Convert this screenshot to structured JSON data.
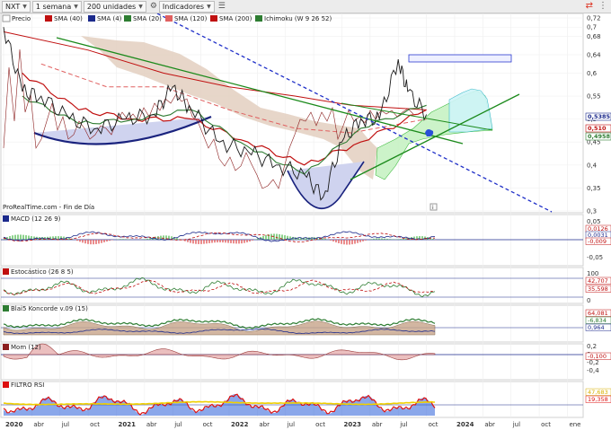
{
  "toolbar": {
    "ticker": "NXT",
    "period": "1 semana",
    "units": "200 unidades",
    "indicators": "Indicadores"
  },
  "legend": {
    "price": "Precio",
    "sma40": "SMA (40)",
    "sma4": "SMA (4)",
    "sma20": "SMA (20)",
    "sma120": "SMA (120)",
    "sma200": "SMA (200)",
    "ichimoku": "Ichimoku (W 9 26 52)"
  },
  "source_text": "ProRealTime.com - Fin de Día",
  "colors": {
    "price": "#1a1a1a",
    "sma40": "#c01010",
    "sma4": "#1c2a8c",
    "sma20": "#2e7d32",
    "sma120": "#e06060",
    "sma200": "#c01010",
    "kumo": "#e3cfc0",
    "kumo_green": "#c7f2c4",
    "cup_fill": "#cfd3ef",
    "cup_line": "#1a237e",
    "trend_green": "#1b8a1b",
    "trend_blue": "#1f2fc8",
    "macd": "#1c2a8c",
    "rsi_red": "#d11",
    "rsi_blue": "#2a5fd8",
    "rsi_yellow": "#f0d000"
  },
  "chart_data": [
    {
      "type": "line",
      "title": "NXT",
      "x_ticks": [
        "2020",
        "abr",
        "jul",
        "oct",
        "2021",
        "abr",
        "jul",
        "oct",
        "2022",
        "abr",
        "jul",
        "oct",
        "2023",
        "abr",
        "jul",
        "oct",
        "2024",
        "abr",
        "jul",
        "oct",
        "ene"
      ],
      "y_ticks": [
        "0,72",
        "0,7",
        "0,68",
        "0,64",
        "0,6",
        "0,55",
        "0,5",
        "0,45",
        "0,4",
        "0,35",
        "0,3"
      ],
      "ylim": [
        0.3,
        0.72
      ],
      "price_tags": [
        {
          "text": "0,5385",
          "color": "#1c2a8c"
        },
        {
          "text": "0,510",
          "color": "#c01010"
        },
        {
          "text": "0,4958",
          "color": "#2e7d32"
        }
      ],
      "series": [
        {
          "name": "Precio",
          "x": [
            "2020-01",
            "2020-03",
            "2020-05",
            "2020-08",
            "2020-11",
            "2021-02",
            "2021-05",
            "2021-07",
            "2021-09",
            "2021-12",
            "2022-03",
            "2022-06",
            "2022-09",
            "2022-11",
            "2023-01",
            "2023-03",
            "2023-05",
            "2023-07",
            "2023-08",
            "2023-10"
          ],
          "values": [
            0.7,
            0.56,
            0.55,
            0.5,
            0.48,
            0.5,
            0.51,
            0.57,
            0.52,
            0.45,
            0.43,
            0.4,
            0.38,
            0.33,
            0.45,
            0.5,
            0.5,
            0.63,
            0.56,
            0.51
          ]
        },
        {
          "name": "SMA (200)",
          "x": [
            "2020-01",
            "2020-10",
            "2021-06",
            "2022-01",
            "2022-08",
            "2023-02",
            "2023-10"
          ],
          "values": [
            0.69,
            0.65,
            0.6,
            0.57,
            0.55,
            0.53,
            0.52
          ]
        },
        {
          "name": "SMA (120)",
          "x": [
            "2020-05",
            "2020-12",
            "2021-06",
            "2022-01",
            "2022-08",
            "2023-02",
            "2023-10"
          ],
          "values": [
            0.62,
            0.57,
            0.57,
            0.52,
            0.48,
            0.47,
            0.5
          ]
        },
        {
          "name": "SMA (40)",
          "x": [
            "2020-03",
            "2020-09",
            "2021-03",
            "2021-09",
            "2022-03",
            "2022-09",
            "2023-03",
            "2023-10"
          ],
          "values": [
            0.6,
            0.52,
            0.5,
            0.5,
            0.45,
            0.4,
            0.45,
            0.52
          ]
        },
        {
          "name": "SMA (20)",
          "x": [
            "2020-03",
            "2020-09",
            "2021-03",
            "2021-09",
            "2022-03",
            "2022-09",
            "2023-03",
            "2023-10"
          ],
          "values": [
            0.55,
            0.49,
            0.5,
            0.52,
            0.44,
            0.38,
            0.48,
            0.53
          ]
        }
      ],
      "annotations": [
        {
          "type": "trendline",
          "color": "green",
          "from": [
            "2020-04",
            0.64
          ],
          "to": [
            "2023-10",
            0.52
          ]
        },
        {
          "type": "trendline",
          "color": "green",
          "from": [
            "2023-01",
            0.4
          ],
          "to": [
            "2024-07",
            0.57
          ]
        },
        {
          "type": "trendline",
          "color": "blue-dashed",
          "from": [
            "2021-04",
            0.71
          ],
          "to": [
            "2024-11",
            0.3
          ]
        },
        {
          "type": "cup",
          "from": "2020-01",
          "to": "2021-06",
          "bottom": 0.47
        },
        {
          "type": "cup",
          "from": "2022-07",
          "to": "2023-03",
          "bottom": 0.31
        },
        {
          "type": "rectangle",
          "from": "2023-06",
          "to": "2024-06",
          "top": 0.64,
          "bottom": 0.625
        }
      ]
    },
    {
      "type": "line",
      "title": "MACD (12 26 9)",
      "y_ticks": [
        "0,05",
        "0",
        "-0,05"
      ],
      "value_tags": [
        "0,0126",
        "0,0031",
        "-0,009"
      ]
    },
    {
      "type": "line",
      "title": "Estocástico (26 8 5)",
      "y_ticks": [
        "100",
        "0"
      ],
      "value_tags": [
        "42,707",
        "35,598"
      ]
    },
    {
      "type": "area",
      "title": "Blai5 Koncorde v.09 (15)",
      "value_tags": [
        "64,081",
        "-6,834",
        "0,964"
      ]
    },
    {
      "type": "line",
      "title": "Mom (12)",
      "y_ticks": [
        "0,2",
        "0",
        "-0,2",
        "-0,4"
      ],
      "value_tags": [
        "-0,100"
      ]
    },
    {
      "type": "area",
      "title": "FILTRO RSI",
      "value_tags": [
        "47,683",
        "19,358"
      ]
    }
  ]
}
